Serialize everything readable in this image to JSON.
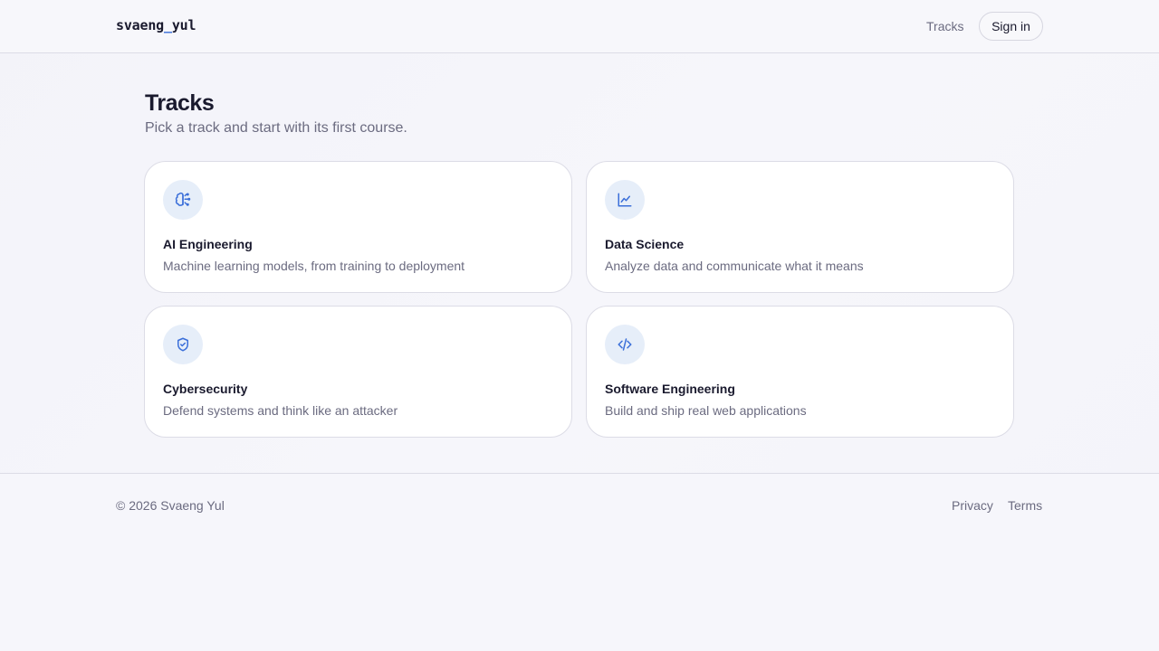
{
  "header": {
    "logo_left": "svaeng",
    "logo_sep": "_",
    "logo_right": "yul",
    "nav_tracks": "Tracks",
    "signin_label": "Sign in"
  },
  "main": {
    "title": "Tracks",
    "subtitle": "Pick a track and start with its first course.",
    "cards": [
      {
        "title": "AI Engineering",
        "desc": "Machine learning models, from training to deployment",
        "icon": "brain-icon"
      },
      {
        "title": "Data Science",
        "desc": "Analyze data and communicate what it means",
        "icon": "chart-line-icon"
      },
      {
        "title": "Cybersecurity",
        "desc": "Defend systems and think like an attacker",
        "icon": "shield-check-icon"
      },
      {
        "title": "Software Engineering",
        "desc": "Build and ship real web applications",
        "icon": "code-icon"
      }
    ]
  },
  "footer": {
    "copyright": "© 2026 Svaeng Yul",
    "privacy": "Privacy",
    "terms": "Terms"
  },
  "colors": {
    "accent": "#3b6fd9",
    "icon_bg": "#e6eef9",
    "text": "#1a1a2e",
    "muted": "#6b6b80"
  }
}
